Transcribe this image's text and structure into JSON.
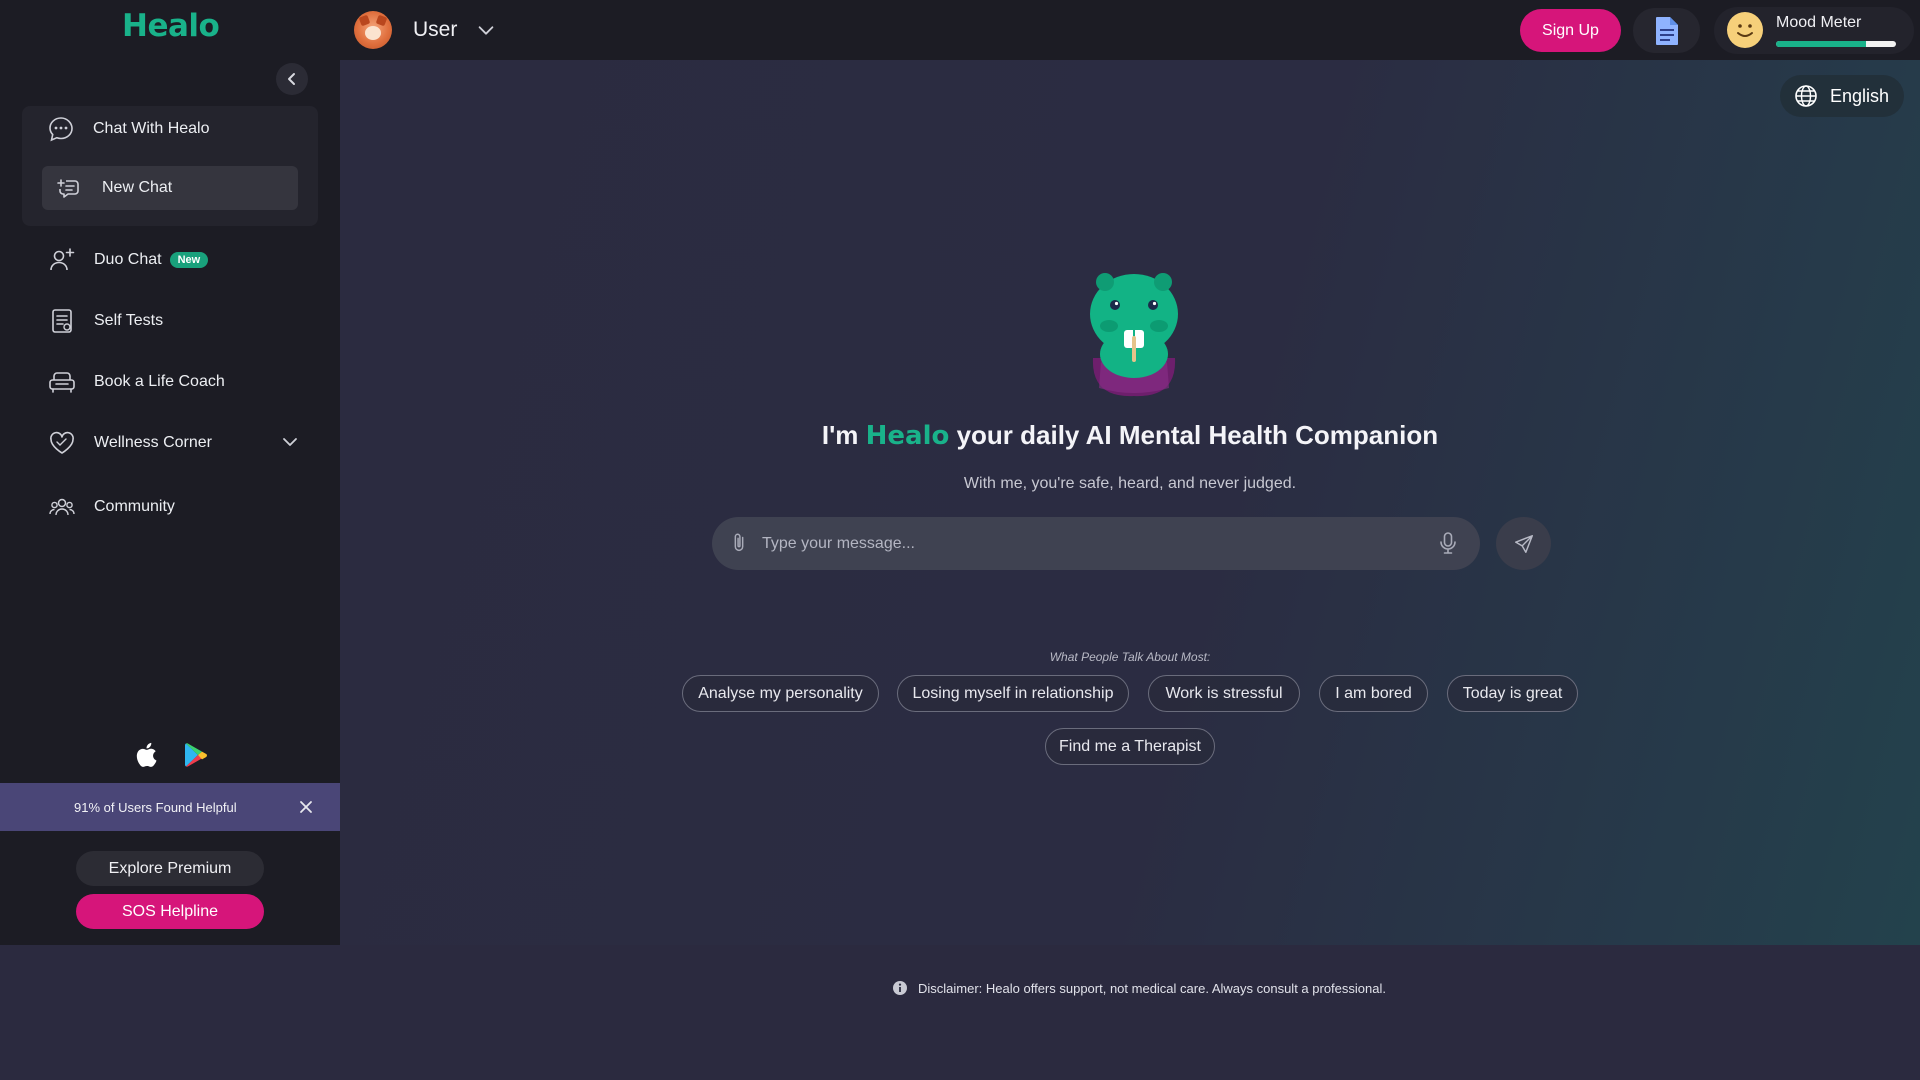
{
  "app": {
    "logo": "Healo",
    "user_name": "User",
    "signup_label": "Sign Up",
    "mood_label": "Mood Meter",
    "mood_level": 0.75,
    "accent_color": "#19b28a",
    "primary_color": "#d6157a"
  },
  "sidebar": {
    "chat_with_healo": "Chat With Healo",
    "new_chat": "New Chat",
    "duo_chat": "Duo Chat",
    "duo_badge": "New",
    "self_tests": "Self Tests",
    "life_coach": "Book a Life Coach",
    "wellness": "Wellness Corner",
    "community": "Community",
    "helpful_text": "91% of Users Found Helpful",
    "explore_premium": "Explore Premium",
    "sos_helpline": "SOS Helpline"
  },
  "main": {
    "language": "English",
    "headline_pre": "I'm",
    "headline_brand": "Healo",
    "headline_post": "your daily AI Mental Health Companion",
    "subline": "With me, you're safe, heard, and never judged.",
    "message_placeholder": "Type your message...",
    "topics_label": "What People Talk About Most:",
    "topics": [
      "Analyse my personality",
      "Losing myself in relationship",
      "Work is stressful",
      "I am bored",
      "Today is great",
      "Find me a Therapist"
    ],
    "disclaimer": "Disclaimer: Healo offers support, not medical care. Always consult a professional."
  },
  "icons": {
    "chat": "chat-bubble-icon",
    "new_chat": "new-chat-icon",
    "duo_chat": "add-user-icon",
    "self_tests": "clipboard-icon",
    "life_coach": "sofa-icon",
    "wellness": "heart-icon",
    "community": "group-icon",
    "language": "globe-icon",
    "attach": "paperclip-icon",
    "mic": "microphone-icon",
    "send": "send-icon",
    "info": "info-icon",
    "document": "document-icon",
    "apple": "apple-icon",
    "play": "play-store-icon"
  }
}
